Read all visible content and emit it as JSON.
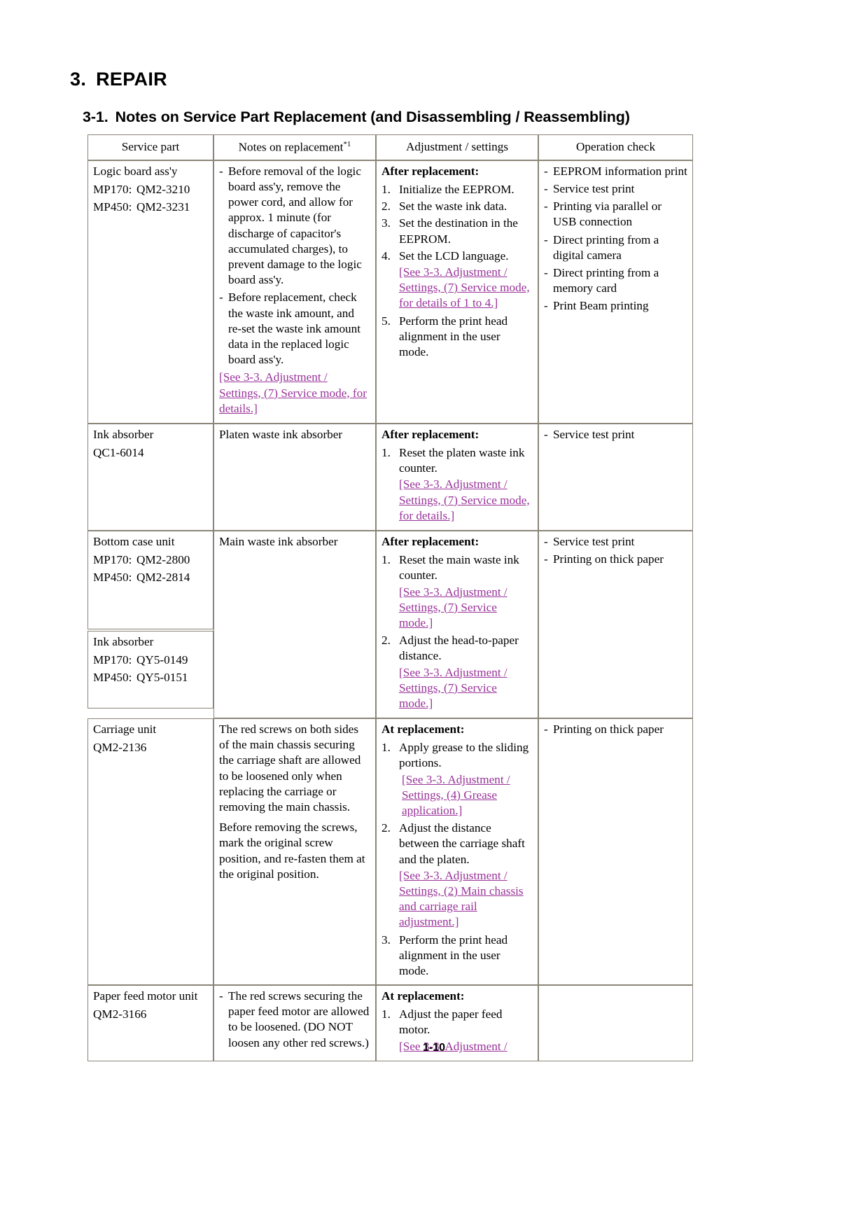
{
  "document": {
    "chapter_number": "3.",
    "chapter_title": "REPAIR",
    "section_number": "3-1.",
    "section_title": "Notes on Service Part Replacement (and Disassembling / Reassembling)",
    "page_footer": "1-10"
  },
  "table": {
    "headers": {
      "service_part": "Service part",
      "notes": "Notes on replacement",
      "notes_footnote": "*1",
      "adjustment": "Adjustment / settings",
      "operation": "Operation check"
    },
    "rows": [
      {
        "part": {
          "name": "Logic board ass'y",
          "numbers": [
            {
              "model": "MP170:",
              "code": "QM2-3210"
            },
            {
              "model": "MP450:",
              "code": "QM2-3231"
            }
          ]
        },
        "notes": {
          "bullets": [
            "Before removal of the logic board ass'y, remove the power cord, and allow for approx. 1 minute (for discharge of capacitor's accumulated charges), to prevent damage to the logic board ass'y.",
            "Before replacement, check the waste ink amount, and re-set the waste ink amount data in the replaced logic board ass'y."
          ],
          "link": "[See 3-3. Adjustment / Settings, (7) Service mode, for details.]"
        },
        "adjustment": {
          "heading": "After replacement:",
          "steps": [
            {
              "marker": "1.",
              "text": "Initialize the EEPROM."
            },
            {
              "marker": "2.",
              "text": "Set the waste ink data."
            },
            {
              "marker": "3.",
              "text": "Set the destination in the EEPROM."
            },
            {
              "marker": "4.",
              "text": "Set the LCD language.",
              "link": "[See 3-3. Adjustment / Settings, (7) Service mode, for details of 1 to 4.]"
            },
            {
              "marker": "5.",
              "text": "Perform the print head alignment in the user mode."
            }
          ]
        },
        "operation": [
          "EEPROM information print",
          "Service test print",
          "Printing via parallel or USB connection",
          "Direct printing from a digital camera",
          "Direct printing from a memory card",
          "Print Beam printing"
        ]
      },
      {
        "part": {
          "name": "Ink absorber",
          "numbers": [
            {
              "model": "QC1-6014",
              "code": ""
            }
          ]
        },
        "notes": {
          "plain": "Platen waste ink absorber"
        },
        "adjustment": {
          "heading": "After replacement:",
          "steps": [
            {
              "marker": "1.",
              "text": "Reset the platen waste ink counter.",
              "link": "[See 3-3. Adjustment / Settings, (7) Service mode, for details.]"
            }
          ]
        },
        "operation": [
          "Service test print"
        ]
      },
      {
        "part_split": {
          "first": {
            "name": "Bottom case unit",
            "numbers": [
              {
                "model": "MP170:",
                "code": "QM2-2800"
              },
              {
                "model": "MP450:",
                "code": "QM2-2814"
              }
            ]
          },
          "second": {
            "name": "Ink absorber",
            "numbers": [
              {
                "model": "MP170:",
                "code": "QY5-0149"
              },
              {
                "model": "MP450:",
                "code": "QY5-0151"
              }
            ]
          }
        },
        "notes": {
          "plain": "Main waste ink absorber"
        },
        "adjustment": {
          "heading": "After replacement:",
          "steps": [
            {
              "marker": "1.",
              "text": "Reset the main waste ink counter.",
              "link": "[See 3-3. Adjustment / Settings, (7) Service mode.]"
            },
            {
              "marker": "2.",
              "text": "Adjust the head-to-paper distance.",
              "link": "[See 3-3. Adjustment / Settings, (7) Service mode.]"
            }
          ]
        },
        "operation": [
          "Service test print",
          "Printing on thick paper"
        ]
      },
      {
        "part": {
          "name": "Carriage unit",
          "numbers": [
            {
              "model": "QM2-2136",
              "code": ""
            }
          ]
        },
        "notes": {
          "paragraphs": [
            "The red screws on both sides of the main chassis securing the carriage shaft are allowed to be loosened only when replacing the carriage or removing the main chassis.",
            "Before removing the screws, mark the original screw position, and re-fasten them at the original position."
          ]
        },
        "adjustment": {
          "heading": "At replacement:",
          "steps": [
            {
              "marker": "1.",
              "text": "Apply grease to the sliding portions.",
              "link": "[See 3-3. Adjustment / Settings, (4) Grease application.]"
            },
            {
              "marker": "2.",
              "text": "Adjust the distance between the carriage shaft and the platen.",
              "link": "[See 3-3. Adjustment / Settings, (2) Main chassis and carriage rail adjustment.]"
            },
            {
              "marker": "3.",
              "text": "Perform the print head alignment in the user mode."
            }
          ]
        },
        "operation": [
          "Printing on thick paper"
        ]
      },
      {
        "part": {
          "name": "Paper feed motor unit",
          "numbers": [
            {
              "model": "QM2-3166",
              "code": ""
            }
          ]
        },
        "notes": {
          "bullets": [
            "The red screws securing the paper feed motor are allowed to be loosened. (DO NOT loosen any other red screws.)"
          ]
        },
        "adjustment": {
          "heading": "At replacement:",
          "steps": [
            {
              "marker": "1.",
              "text": "Adjust the paper feed motor.",
              "link": "[See 3-3. Adjustment /"
            }
          ]
        },
        "operation": []
      }
    ]
  }
}
